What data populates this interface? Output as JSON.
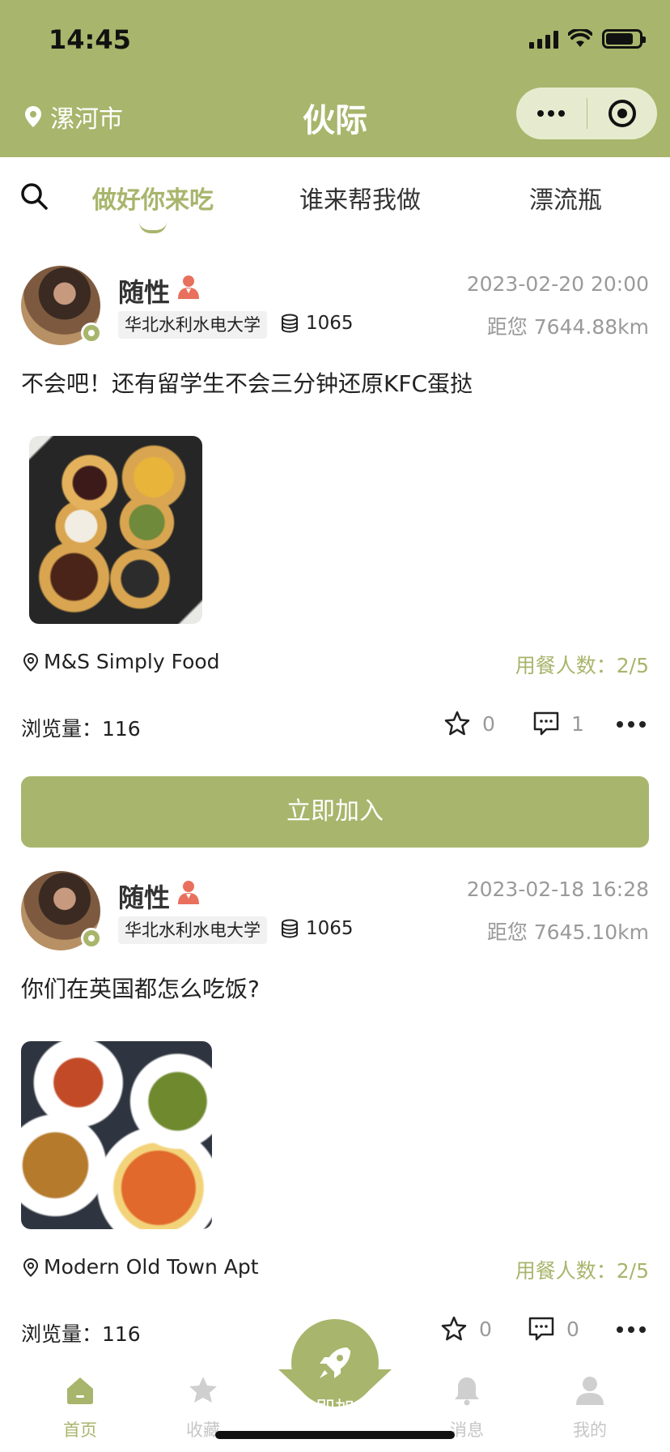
{
  "status_bar": {
    "time": "14:45"
  },
  "header": {
    "city": "漯河市",
    "title": "伙际"
  },
  "colors": {
    "accent": "#a8b56c",
    "muted": "#9a9a9a",
    "gender": "#e8705d"
  },
  "tabs": [
    {
      "label": "做好你来吃",
      "active": true
    },
    {
      "label": "谁来帮我做",
      "active": false
    },
    {
      "label": "漂流瓶",
      "active": false
    }
  ],
  "posts": [
    {
      "author": "随性",
      "school": "华北水利水电大学",
      "coins": "1065",
      "time": "2023-02-20 20:00",
      "distance": "距您 7644.88km",
      "text": "不会吧！还有留学生不会三分钟还原KFC蛋挞",
      "location": "M&S Simply Food",
      "diners": "用餐人数：2/5",
      "views": "浏览量：116",
      "favorites": "0",
      "comments": "1",
      "join_label": "立即加入"
    },
    {
      "author": "随性",
      "school": "华北水利水电大学",
      "coins": "1065",
      "time": "2023-02-18 16:28",
      "distance": "距您 7645.10km",
      "text": "你们在英国都怎么吃饭?",
      "location": "Modern Old Town Apt",
      "diners": "用餐人数：2/5",
      "views": "浏览量：116",
      "favorites": "0",
      "comments": "0"
    }
  ],
  "tabbar": {
    "items": [
      {
        "label": "首页",
        "icon": "home-icon",
        "active": true
      },
      {
        "label": "收藏",
        "icon": "star-icon",
        "active": false
      },
      {
        "label": "消息",
        "icon": "bell-icon",
        "active": false
      },
      {
        "label": "我的",
        "icon": "user-icon",
        "active": false
      }
    ],
    "center_label": "立即加入",
    "center_icon": "rocket-icon"
  }
}
